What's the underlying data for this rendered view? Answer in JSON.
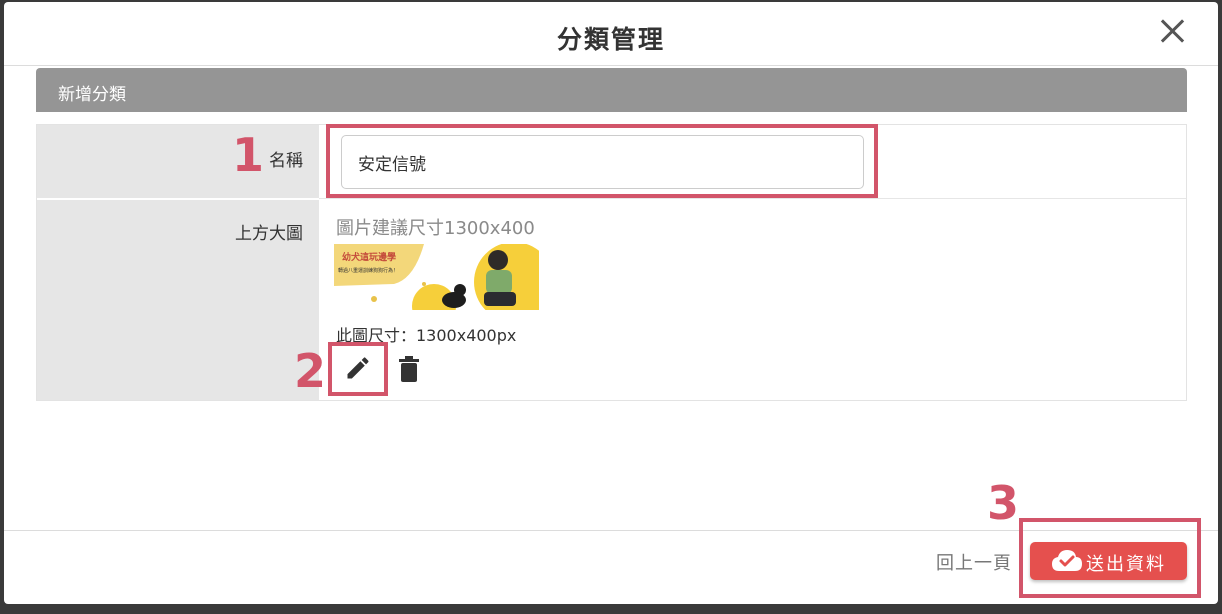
{
  "modal": {
    "title": "分類管理"
  },
  "section": {
    "title": "新增分類"
  },
  "form": {
    "name_label": "名稱",
    "name_value": "安定信號",
    "banner_label": "上方大圖",
    "banner_hint": "圖片建議尺寸1300x400",
    "banner_size_text": "此圖尺寸：1300x400px",
    "banner_image_title": "幼犬這玩邊學",
    "banner_image_subtitle": "轉過八重運訓練狗狗行為！"
  },
  "footer": {
    "back_label": "回上一頁",
    "submit_label": "送出資料"
  },
  "annotations": {
    "step1": "1",
    "step2": "2",
    "step3": "3"
  },
  "colors": {
    "accent": "#e5504e",
    "annotation": "#d2556a",
    "section_bar": "#959595",
    "label_bg": "#e6e6e6"
  },
  "icons": [
    "close-icon",
    "pencil-icon",
    "trash-icon",
    "cloud-check-icon"
  ]
}
